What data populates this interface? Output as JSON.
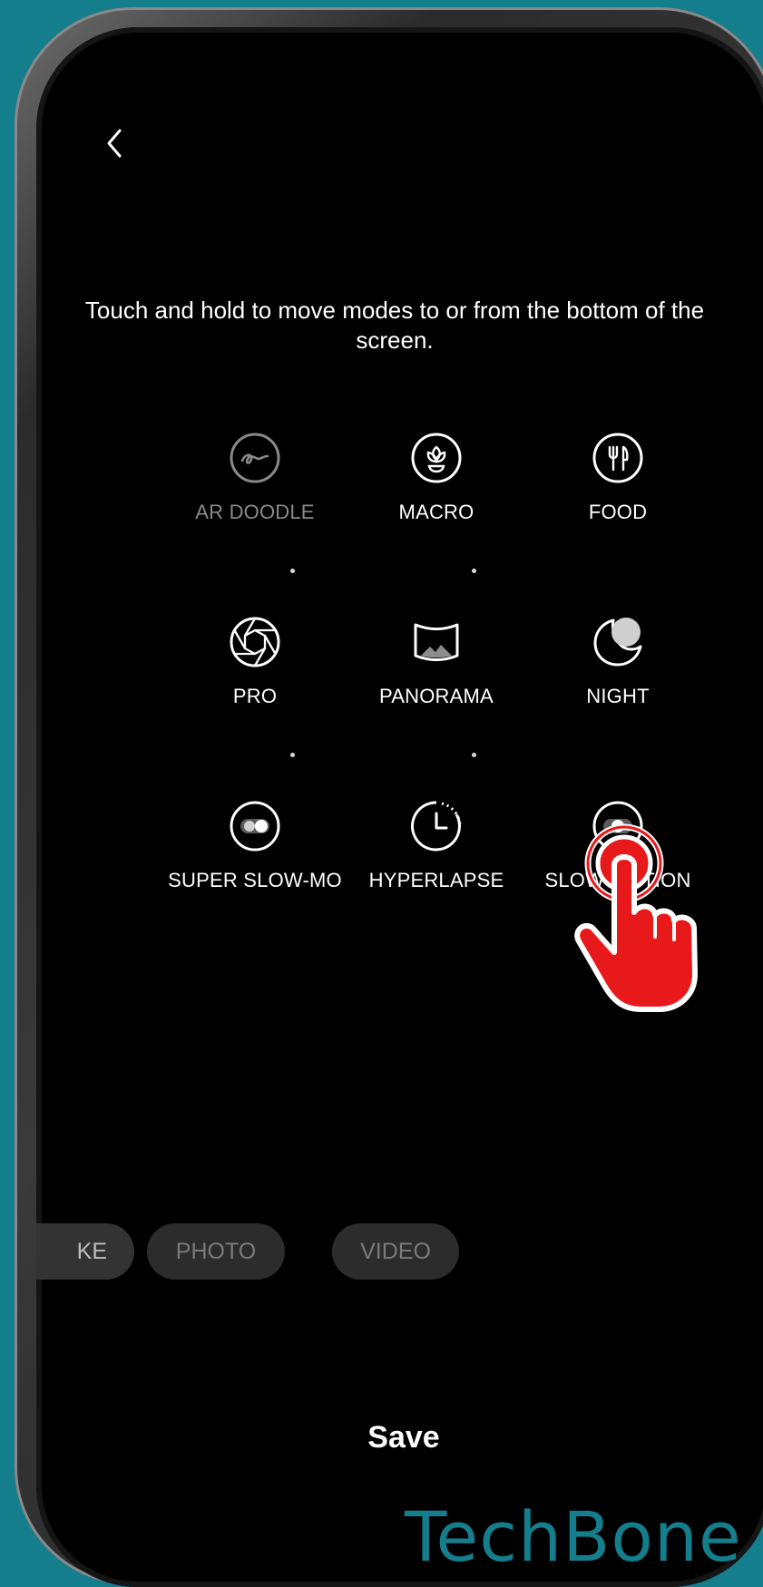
{
  "header": {
    "back_icon": "chevron-left-icon"
  },
  "instruction_text": "Touch and hold to move modes to or from the bottom of the screen.",
  "modes": [
    {
      "label": "AR DOODLE",
      "icon": "ar-doodle-icon",
      "enabled": false
    },
    {
      "label": "MACRO",
      "icon": "macro-flower-icon",
      "enabled": true
    },
    {
      "label": "FOOD",
      "icon": "food-utensils-icon",
      "enabled": true
    },
    {
      "label": "PRO",
      "icon": "aperture-icon",
      "enabled": true
    },
    {
      "label": "PANORAMA",
      "icon": "panorama-icon",
      "enabled": true
    },
    {
      "label": "NIGHT",
      "icon": "moon-icon",
      "enabled": true
    },
    {
      "label": "SUPER SLOW-MO",
      "icon": "super-slow-mo-icon",
      "enabled": true
    },
    {
      "label": "HYPERLAPSE",
      "icon": "hyperlapse-timer-icon",
      "enabled": true
    },
    {
      "label": "SLOW MOTION",
      "icon": "slow-motion-icon",
      "enabled": true
    }
  ],
  "bottom_bar": {
    "partial_label": "KE",
    "photo_label": "PHOTO",
    "video_label": "VIDEO"
  },
  "save_label": "Save",
  "watermark": "TechBone",
  "overlay": {
    "pointer_icon": "hand-pointer-icon",
    "color": "#e8191b"
  },
  "colors": {
    "background": "#147e8c",
    "screen": "#000000",
    "text": "#ffffff",
    "disabled_text": "#8a8a8a",
    "pill_bg": "#2c2c2c"
  }
}
